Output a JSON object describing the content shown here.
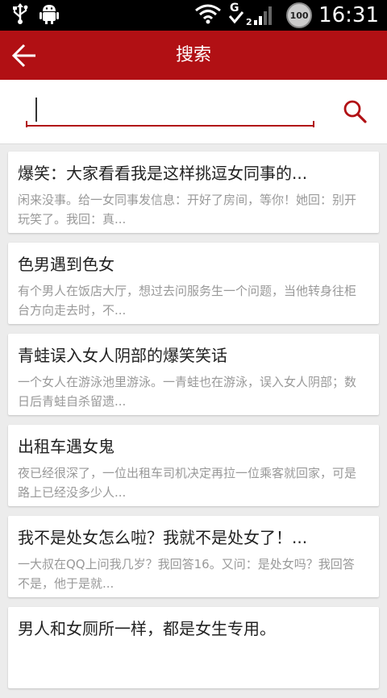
{
  "status_bar": {
    "time": "16:31",
    "battery_level": "100",
    "icons": [
      "usb-icon",
      "android-debug-icon",
      "wifi-icon",
      "signal-icon",
      "battery-icon"
    ]
  },
  "app_bar": {
    "title": "搜索",
    "back_icon": "arrow-left-icon",
    "color": "#b11014"
  },
  "search": {
    "value": "",
    "placeholder": "",
    "button_icon": "search-icon"
  },
  "items": [
    {
      "title": "爆笑：大家看看我是这样挑逗女同事的...",
      "summary": "闲来没事。给一女同事发信息：开好了房间，等你！她回：别开玩笑了。我回：真..."
    },
    {
      "title": "色男遇到色女",
      "summary": "有个男人在饭店大厅，想过去问服务生一个问题，当他转身往柜台方向走去时，不..."
    },
    {
      "title": "青蛙误入女人阴部的爆笑笑话",
      "summary": "一个女人在游泳池里游泳。一青蛙也在游泳，误入女人阴部；数日后青蛙自杀留遗..."
    },
    {
      "title": "出租车遇女鬼",
      "summary": "夜已经很深了，一位出租车司机决定再拉一位乘客就回家，可是路上已经没多少人..."
    },
    {
      "title": "我不是处女怎么啦？我就不是处女了！...",
      "summary": "一大叔在QQ上问我几岁？我回答16。又问：是处女吗？我回答不是，他于是就..."
    },
    {
      "title": "男人和女厕所一样，都是女生专用。",
      "summary": ""
    }
  ]
}
